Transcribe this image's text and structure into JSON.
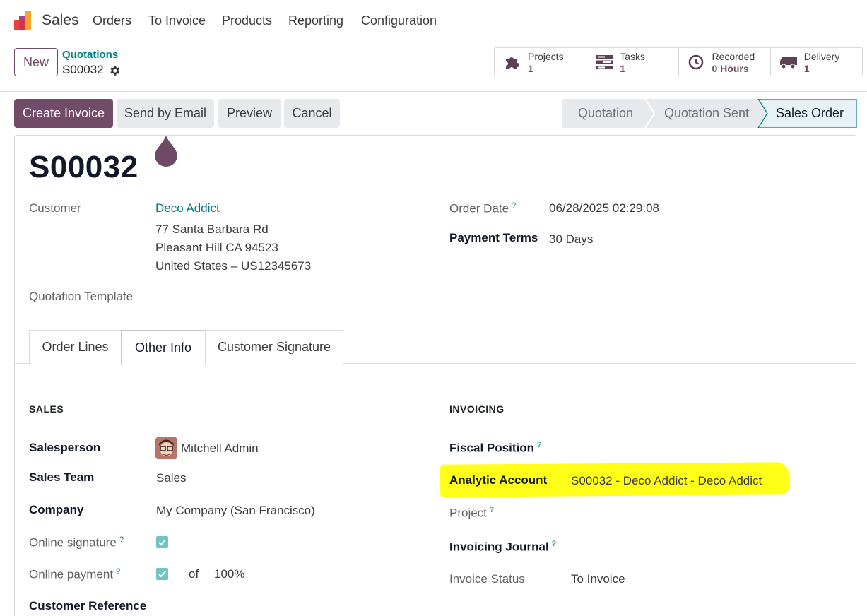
{
  "nav": {
    "app_name": "Sales",
    "menu": [
      "Orders",
      "To Invoice",
      "Products",
      "Reporting",
      "Configuration"
    ]
  },
  "control_panel": {
    "new_label": "New",
    "breadcrumb_parent": "Quotations",
    "breadcrumb_current": "S00032"
  },
  "smart_buttons": [
    {
      "title": "Projects",
      "value": "1",
      "icon": "puzzle-icon"
    },
    {
      "title": "Tasks",
      "value": "1",
      "icon": "tasks-icon"
    },
    {
      "title": "Recorded",
      "value": "0 Hours",
      "icon": "clock-icon"
    },
    {
      "title": "Delivery",
      "value": "1",
      "icon": "truck-icon"
    }
  ],
  "actions": {
    "create_invoice": "Create Invoice",
    "send_by_email": "Send by Email",
    "preview": "Preview",
    "cancel": "Cancel"
  },
  "status": {
    "steps": [
      "Quotation",
      "Quotation Sent",
      "Sales Order"
    ],
    "active": "Sales Order"
  },
  "record": {
    "name": "S00032",
    "customer_label": "Customer",
    "customer_name": "Deco Addict",
    "address_line1": "77 Santa Barbara Rd",
    "address_line2": "Pleasant Hill CA 94523",
    "address_line3": "United States – US12345673",
    "quotation_template_label": "Quotation Template",
    "order_date_label": "Order Date",
    "order_date": "06/28/2025 02:29:08",
    "payment_terms_label": "Payment Terms",
    "payment_terms": "30 Days",
    "help_mark": "?"
  },
  "tabs": [
    "Order Lines",
    "Other Info",
    "Customer Signature"
  ],
  "sales": {
    "heading": "SALES",
    "salesperson_label": "Salesperson",
    "salesperson": "Mitchell Admin",
    "team_label": "Sales Team",
    "team": "Sales",
    "company_label": "Company",
    "company": "My Company (San Francisco)",
    "online_signature_label": "Online signature",
    "online_signature": true,
    "online_payment_label": "Online payment",
    "online_payment": true,
    "of_label": "of",
    "prepayment_percent": "100%",
    "customer_reference_label": "Customer Reference"
  },
  "invoicing": {
    "heading": "INVOICING",
    "fiscal_position_label": "Fiscal Position",
    "analytic_account_label": "Analytic Account",
    "analytic_account": "S00032 - Deco Addict - Deco Addict",
    "project_label": "Project",
    "journal_label": "Invoicing Journal",
    "invoice_status_label": "Invoice Status",
    "invoice_status": "To Invoice"
  },
  "colors": {
    "brand": "#714b67",
    "link": "#017e84",
    "highlight": "#ffff18",
    "checkbox": "#71c4c4"
  }
}
